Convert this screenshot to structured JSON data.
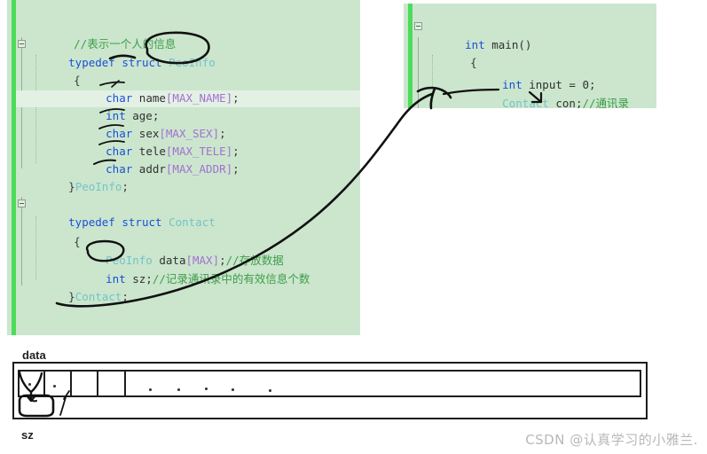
{
  "code_left": {
    "background": "#cbe6cd",
    "change_bar_color": "#4ddb5a",
    "lines": [
      {
        "text": "//表示一个人的信息"
      },
      {
        "text": "typedef struct PeoInfo"
      },
      {
        "text": "{"
      },
      {
        "text": "    char name[MAX_NAME];"
      },
      {
        "text": "    int age;"
      },
      {
        "text": "    char sex[MAX_SEX];"
      },
      {
        "text": "    char tele[MAX_TELE];"
      },
      {
        "text": "    char addr[MAX_ADDR];"
      },
      {
        "text": "}PeoInfo;"
      },
      {
        "text": ""
      },
      {
        "text": "typedef struct Contact"
      },
      {
        "text": "{"
      },
      {
        "text": "    PeoInfo data[MAX];//存放数据"
      },
      {
        "text": "    int sz;//记录通讯录中的有效信息个数"
      },
      {
        "text": "}Contact;"
      }
    ],
    "tokens": {
      "comment_person": "//表示一个人的信息",
      "typedef": "typedef",
      "struct": "struct",
      "peoinfo_type": "PeoInfo",
      "brace_open": "{",
      "char": "char",
      "int": "int",
      "name": " name",
      "age": " age;",
      "sex": " sex",
      "tele": " tele",
      "addr": " addr",
      "max_name": "[MAX_NAME]",
      "max_sex": "[MAX_SEX]",
      "max_tele": "[MAX_TELE]",
      "max_addr": "[MAX_ADDR]",
      "semi": ";",
      "close_peoinfo": "}",
      "peoinfo_name": "PeoInfo",
      "contact_type": "Contact",
      "peoinfo_member": "PeoInfo",
      "data_member": " data",
      "max_idx": "[MAX]",
      "comment_store": "//存放数据",
      "sz_member": " sz;",
      "comment_count": "//记录通讯录中的有效信息个数",
      "close_contact": "}",
      "contact_name": "Contact"
    }
  },
  "code_right": {
    "background": "#cbe6cd",
    "change_bar_color": "#4ddb5a",
    "lines": [
      {
        "text": "int main()"
      },
      {
        "text": "{"
      },
      {
        "text": "    int input = 0;"
      },
      {
        "text": "    Contact con;//通讯录"
      }
    ],
    "tokens": {
      "int": "int",
      "main": " main()",
      "brace_open": "{",
      "int2": "int",
      "input": " input = 0;",
      "contact_type": "Contact",
      "con_var": " con;",
      "comment_addressbook": "//通讯录"
    }
  },
  "diagram": {
    "data_label": "data",
    "sz_label": "sz",
    "cell_count": 4,
    "ellipsis_dots": 5
  },
  "watermark": {
    "text": "CSDN @认真学习的小雅兰."
  },
  "colors": {
    "keyword": "#1b4fd8",
    "type": "#74c3c8",
    "macro": "#a46fd4",
    "comment": "#3f9c4a",
    "identifier": "#313131",
    "panel_bg": "#cbe6cd",
    "change_bar": "#4ddb5a",
    "ink": "#111111",
    "watermark": "#b8b8b8"
  }
}
